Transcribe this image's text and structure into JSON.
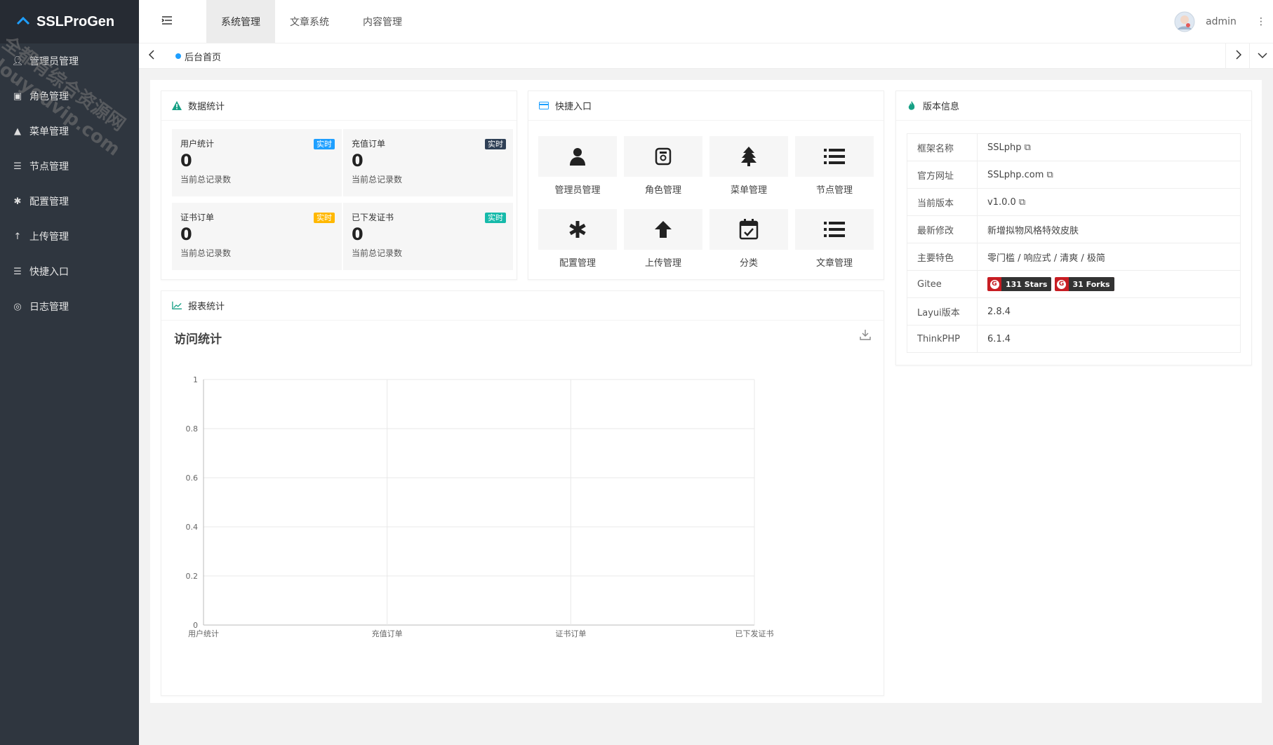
{
  "app": {
    "title": "SSLProGen"
  },
  "sidebar": {
    "items": [
      {
        "label": "管理员管理",
        "icon": "user-icon"
      },
      {
        "label": "角色管理",
        "icon": "role-icon"
      },
      {
        "label": "菜单管理",
        "icon": "tree-icon"
      },
      {
        "label": "节点管理",
        "icon": "list-icon"
      },
      {
        "label": "配置管理",
        "icon": "asterisk-icon"
      },
      {
        "label": "上传管理",
        "icon": "arrow-up-icon"
      },
      {
        "label": "快捷入口",
        "icon": "list-icon"
      },
      {
        "label": "日志管理",
        "icon": "log-icon"
      }
    ]
  },
  "header": {
    "menus": [
      "系统管理",
      "文章系统",
      "内容管理"
    ],
    "active_menu": "系统管理",
    "user": "admin"
  },
  "tabs": {
    "items": [
      "后台首页"
    ]
  },
  "stats": {
    "title": "数据统计",
    "items": [
      {
        "title": "用户统计",
        "badge": "实时",
        "badge_color": "#1e9fff",
        "value": "0",
        "desc": "当前总记录数"
      },
      {
        "title": "充值订单",
        "badge": "实时",
        "badge_color": "#2f4056",
        "value": "0",
        "desc": "当前总记录数"
      },
      {
        "title": "证书订单",
        "badge": "实时",
        "badge_color": "#ffb800",
        "value": "0",
        "desc": "当前总记录数"
      },
      {
        "title": "已下发证书",
        "badge": "实时",
        "badge_color": "#16baaa",
        "value": "0",
        "desc": "当前总记录数"
      }
    ]
  },
  "quick": {
    "title": "快捷入口",
    "items": [
      {
        "label": "管理员管理",
        "icon": "user-icon"
      },
      {
        "label": "角色管理",
        "icon": "role-icon"
      },
      {
        "label": "菜单管理",
        "icon": "tree-icon"
      },
      {
        "label": "节点管理",
        "icon": "list-icon"
      },
      {
        "label": "配置管理",
        "icon": "asterisk-icon"
      },
      {
        "label": "上传管理",
        "icon": "arrow-up-icon"
      },
      {
        "label": "分类",
        "icon": "calendar-icon"
      },
      {
        "label": "文章管理",
        "icon": "list-icon"
      }
    ]
  },
  "version": {
    "title": "版本信息",
    "rows": [
      {
        "key": "框架名称",
        "value": "SSLphp",
        "copy": true
      },
      {
        "key": "官方网址",
        "value": "SSLphp.com",
        "copy": true
      },
      {
        "key": "当前版本",
        "value": "v1.0.0",
        "copy": true
      },
      {
        "key": "最新修改",
        "value": "新增拟物风格特效皮肤"
      },
      {
        "key": "主要特色",
        "value": "零门槛 / 响应式 / 清爽 / 极简"
      },
      {
        "key": "Gitee",
        "stars": "131 Stars",
        "forks": "31 Forks"
      },
      {
        "key": "Layui版本",
        "value": "2.8.4"
      },
      {
        "key": "ThinkPHP",
        "value": "6.1.4"
      }
    ]
  },
  "report": {
    "title": "报表统计"
  },
  "chart_data": {
    "type": "line",
    "title": "访问统计",
    "categories": [
      "用户统计",
      "充值订单",
      "证书订单",
      "已下发证书"
    ],
    "series": [
      {
        "values": [
          0,
          0,
          0,
          0
        ]
      }
    ],
    "ylim": [
      0,
      1
    ],
    "yticks": [
      "0",
      "0.2",
      "0.4",
      "0.6",
      "0.8",
      "1"
    ],
    "grid": true
  },
  "watermark": {
    "lines": [
      "全都有综合资源网",
      "douyouvip.com"
    ]
  }
}
